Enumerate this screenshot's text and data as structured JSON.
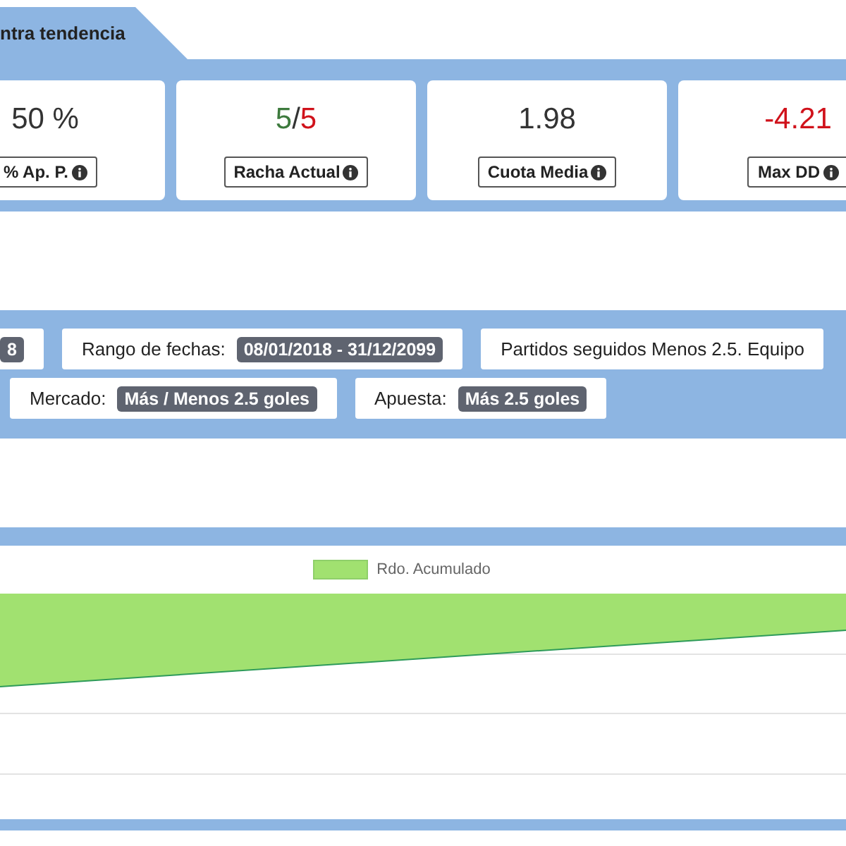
{
  "tab": {
    "label": "ntra tendencia",
    "selected": true
  },
  "stats": [
    {
      "value": [
        {
          "text": "50 %",
          "color": "#333333"
        }
      ],
      "label": "% Ap. P."
    },
    {
      "value": [
        {
          "text": "5",
          "color": "#3d7a3d"
        },
        {
          "text": "/",
          "color": "#333333"
        },
        {
          "text": "5",
          "color": "#d0121b"
        }
      ],
      "label": "Racha Actual"
    },
    {
      "value": [
        {
          "text": "1.98",
          "color": "#333333"
        }
      ],
      "label": "Cuota Media"
    },
    {
      "value": [
        {
          "text": "-4.21",
          "color": "#d0121b"
        }
      ],
      "label": "Max DD"
    }
  ],
  "filters": [
    [
      {
        "badge": "8"
      },
      {
        "label": "Rango de fechas:",
        "badge": "08/01/2018 - 31/12/2099"
      },
      {
        "label": "Partidos seguidos Menos 2.5. Equipo"
      }
    ],
    [
      {
        "label": "Mercado:",
        "badge": "Más / Menos 2.5 goles"
      },
      {
        "label": "Apuesta:",
        "badge": "Más 2.5 goles"
      }
    ]
  ],
  "chart": {
    "legend": "Rdo. Acumulado"
  }
}
